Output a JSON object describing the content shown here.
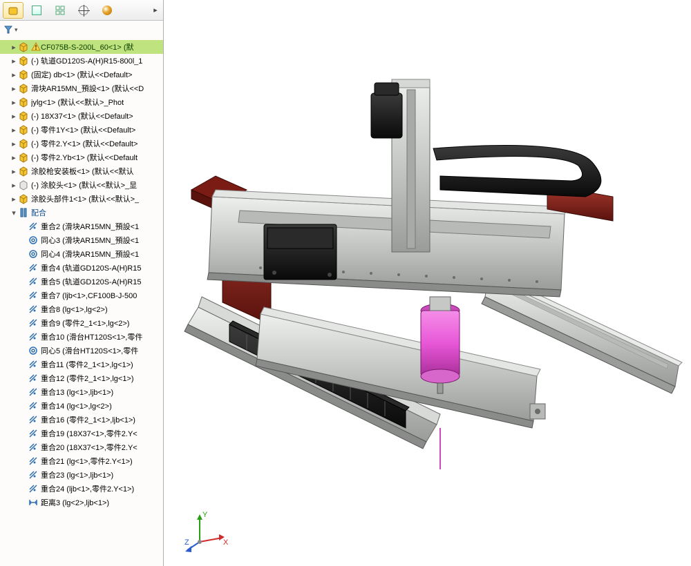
{
  "tabs": [
    "assembly",
    "list",
    "config",
    "cross",
    "sphere"
  ],
  "tree": [
    {
      "lvl": 1,
      "exp": "▸",
      "icon": "assembly",
      "warn": true,
      "sel": true,
      "text": "CF075B-S-200L_60<1> (默"
    },
    {
      "lvl": 1,
      "exp": "▸",
      "icon": "assembly",
      "text": "(-) 轨道GD120S-A(H)R15-800l_1"
    },
    {
      "lvl": 1,
      "exp": "▸",
      "icon": "assembly",
      "text": "(固定) db<1> (默认<<Default>"
    },
    {
      "lvl": 1,
      "exp": "▸",
      "icon": "assembly",
      "text": "滑块AR15MN_預設<1> (默认<<D"
    },
    {
      "lvl": 1,
      "exp": "▸",
      "icon": "assembly",
      "text": "jylg<1> (默认<<默认>_Phot"
    },
    {
      "lvl": 1,
      "exp": "▸",
      "icon": "assembly",
      "text": "(-) 18X37<1> (默认<<Default>"
    },
    {
      "lvl": 1,
      "exp": "▸",
      "icon": "assembly",
      "text": "(-) 零件1Y<1> (默认<<Default>"
    },
    {
      "lvl": 1,
      "exp": "▸",
      "icon": "assembly",
      "text": "(-) 零件2.Y<1> (默认<<Default>"
    },
    {
      "lvl": 1,
      "exp": "▸",
      "icon": "assembly",
      "text": "(-) 零件2.Yb<1> (默认<<Default"
    },
    {
      "lvl": 1,
      "exp": "▸",
      "icon": "assembly",
      "text": "涂胶枪安装板<1> (默认<<默认"
    },
    {
      "lvl": 1,
      "exp": "▸",
      "icon": "suppressed",
      "text": "(-) 涂胶头<1> (默认<<默认>_显"
    },
    {
      "lvl": 1,
      "exp": "▸",
      "icon": "assembly",
      "text": "涂胶头部件1<1> (默认<<默认>_"
    },
    {
      "lvl": 1,
      "exp": "▾",
      "icon": "matefolder",
      "blue": true,
      "text": "配合"
    },
    {
      "lvl": 2,
      "icon": "coincident",
      "text": "重合2 (滑块AR15MN_預設<1"
    },
    {
      "lvl": 2,
      "icon": "concentric",
      "text": "同心3 (滑块AR15MN_預設<1"
    },
    {
      "lvl": 2,
      "icon": "concentric",
      "text": "同心4 (滑块AR15MN_預設<1"
    },
    {
      "lvl": 2,
      "icon": "coincident",
      "text": "重合4 (轨道GD120S-A(H)R15"
    },
    {
      "lvl": 2,
      "icon": "coincident",
      "text": "重合5 (轨道GD120S-A(H)R15"
    },
    {
      "lvl": 2,
      "icon": "coincident",
      "text": "重合7 (ljb<1>,CF100B-J-500"
    },
    {
      "lvl": 2,
      "icon": "coincident",
      "text": "重合8 (lg<1>,lg<2>)"
    },
    {
      "lvl": 2,
      "icon": "coincident",
      "text": "重合9 (零件2_1<1>,lg<2>)"
    },
    {
      "lvl": 2,
      "icon": "coincident",
      "text": "重合10 (滑台HT120S<1>,零件"
    },
    {
      "lvl": 2,
      "icon": "concentric",
      "text": "同心5 (滑台HT120S<1>,零件"
    },
    {
      "lvl": 2,
      "icon": "coincident",
      "text": "重合11 (零件2_1<1>,lg<1>)"
    },
    {
      "lvl": 2,
      "icon": "coincident",
      "text": "重合12 (零件2_1<1>,lg<1>)"
    },
    {
      "lvl": 2,
      "icon": "coincident",
      "text": "重合13 (lg<1>,ljb<1>)"
    },
    {
      "lvl": 2,
      "icon": "coincident",
      "text": "重合14 (lg<1>,lg<2>)"
    },
    {
      "lvl": 2,
      "icon": "coincident",
      "text": "重合16 (零件2_1<1>,ljb<1>)"
    },
    {
      "lvl": 2,
      "icon": "coincident",
      "text": "重合19 (18X37<1>,零件2.Y<"
    },
    {
      "lvl": 2,
      "icon": "coincident",
      "text": "重合20 (18X37<1>,零件2.Y<"
    },
    {
      "lvl": 2,
      "icon": "coincident",
      "text": "重合21 (lg<1>,零件2.Y<1>)"
    },
    {
      "lvl": 2,
      "icon": "coincident",
      "text": "重合23 (lg<1>,ljb<1>)"
    },
    {
      "lvl": 2,
      "icon": "coincident",
      "text": "重合24 (ljb<1>,零件2.Y<1>)"
    },
    {
      "lvl": 2,
      "icon": "distance",
      "text": "距离3 (lg<2>,ljb<1>)"
    }
  ],
  "colors": {
    "rail": "#c6c8c6",
    "railDark": "#8a8c8a",
    "railLight": "#e9ebe9",
    "red": "#7a1b14",
    "redLight": "#a83a2f",
    "magenta": "#e857d7",
    "magentaDark": "#a92e9a",
    "black": "#1d1d1d"
  },
  "triad": {
    "x": "X",
    "y": "Y",
    "z": "Z"
  }
}
